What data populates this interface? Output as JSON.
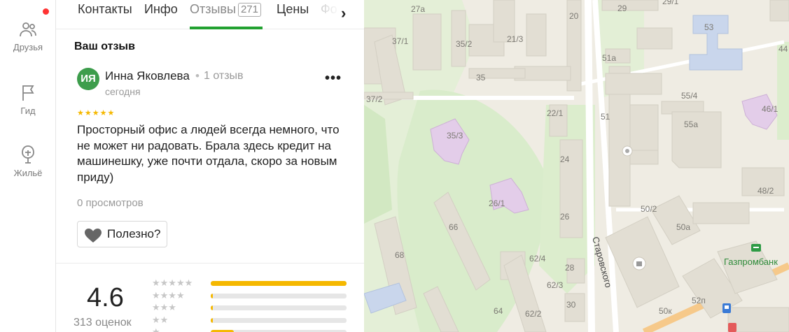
{
  "rail": {
    "items": [
      {
        "label": "Друзья",
        "icon": "friends-icon"
      },
      {
        "label": "Гид",
        "icon": "flag-icon"
      },
      {
        "label": "Жильё",
        "icon": "house-icon"
      }
    ],
    "notification_color": "#ff3333"
  },
  "tabs": [
    {
      "label": "Контакты"
    },
    {
      "label": "Инфо"
    },
    {
      "label": "Отзывы",
      "count": "271",
      "active": true
    },
    {
      "label": "Цены"
    },
    {
      "label": "Фо"
    }
  ],
  "review": {
    "section_title": "Ваш отзыв",
    "avatar_initials": "ИЯ",
    "author": "Инна Яковлева",
    "separator": "•",
    "author_reviews": "1 отзыв",
    "date": "сегодня",
    "stars": "★★★★★",
    "more": "•••",
    "text": "Просторный офис а людей всегда немного, что не может ни радовать. Брала здесь кредит на машинешку, уже почти отдала, скоро за новым приду)",
    "views": "0 просмотров",
    "useful_label": "Полезно?"
  },
  "rating": {
    "value": "4.6",
    "count_label": "313 оценок",
    "distribution": [
      {
        "stars": "★★★★★",
        "fraction": 1.0
      },
      {
        "stars": "★★★★",
        "fraction": 0.01
      },
      {
        "stars": "★★★",
        "fraction": 0.01
      },
      {
        "stars": "★★",
        "fraction": 0.01
      },
      {
        "stars": "★",
        "fraction": 0.17
      }
    ]
  },
  "map": {
    "street": "Старовского",
    "poi": "Газпромбанк",
    "building_labels": [
      "27а",
      "20",
      "29",
      "29/1",
      "37/1",
      "35/2",
      "21/3",
      "53",
      "44",
      "35",
      "51а",
      "37/2",
      "55/4",
      "22/1",
      "51",
      "46/1",
      "35/3",
      "55а",
      "24",
      "48/2",
      "26/1",
      "50/2",
      "66",
      "50а",
      "26",
      "68",
      "62/4",
      "28",
      "62/3",
      "30",
      "64",
      "62/2",
      "50к",
      "52п"
    ],
    "colors": {
      "green": "#d9eccb",
      "building": "#e2ded3",
      "highlight": "#e3cde9",
      "blue": "#c9d6ec",
      "road": "#ffffff"
    }
  }
}
